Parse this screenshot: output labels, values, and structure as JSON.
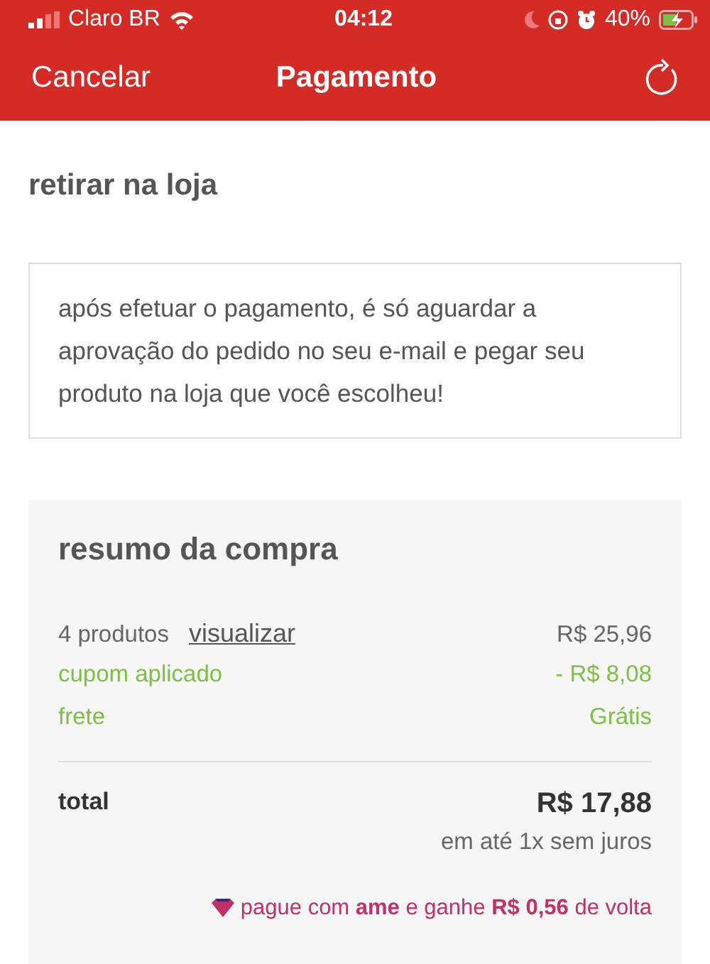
{
  "status_bar": {
    "carrier": "Claro BR",
    "time": "04:12",
    "battery": "40%"
  },
  "nav": {
    "cancel": "Cancelar",
    "title": "Pagamento"
  },
  "section_title": "retirar na loja",
  "info": "após efetuar o pagamento, é só aguardar a aprovação do pedido no seu e-mail e pegar seu produto na loja que você escolheu!",
  "summary": {
    "title": "resumo da compra",
    "lines": [
      {
        "kind": "normal",
        "label": "4 produtos",
        "link": "visualizar",
        "value": "R$ 25,96"
      },
      {
        "kind": "discount",
        "label": "cupom aplicado",
        "value": "- R$ 8,08"
      },
      {
        "kind": "discount",
        "label": "frete",
        "value": "Grátis"
      }
    ],
    "total_label": "total",
    "total_value": "R$ 17,88",
    "installments": "em até 1x sem juros",
    "cashback": "pague com **ame** e ganhe **R$ 0,56** de volta"
  }
}
